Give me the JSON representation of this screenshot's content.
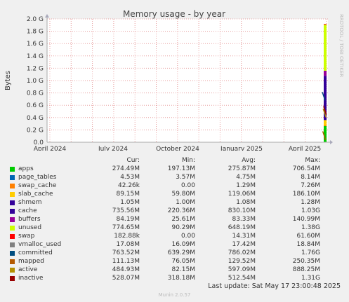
{
  "chart_data": {
    "type": "area",
    "title": "Memory usage - by year",
    "ylabel": "Bytes",
    "side_label": "RRDTOOL / TOBI OETIKER",
    "ylim": [
      0,
      2.0
    ],
    "y_ticks": [
      "0.0",
      "0.2 G",
      "0.4 G",
      "0.6 G",
      "0.8 G",
      "1.0 G",
      "1.2 G",
      "1.4 G",
      "1.6 G",
      "1.8 G",
      "2.0 G"
    ],
    "x_ticks": [
      "April 2024",
      "July 2024",
      "October 2024",
      "January 2025",
      "April 2025"
    ],
    "grid": true,
    "columns": [
      "Cur:",
      "Min:",
      "Avg:",
      "Max:"
    ],
    "series": [
      {
        "name": "apps",
        "color": "#00cc00",
        "cur": "274.49M",
        "min": "197.13M",
        "avg": "275.87M",
        "max": "706.54M"
      },
      {
        "name": "page_tables",
        "color": "#0066b3",
        "cur": "4.53M",
        "min": "3.57M",
        "avg": "4.75M",
        "max": "8.14M"
      },
      {
        "name": "swap_cache",
        "color": "#ff8000",
        "cur": "42.26k",
        "min": "0.00",
        "avg": "1.29M",
        "max": "7.26M"
      },
      {
        "name": "slab_cache",
        "color": "#ffcc00",
        "cur": "89.15M",
        "min": "59.80M",
        "avg": "119.06M",
        "max": "186.10M"
      },
      {
        "name": "shmem",
        "color": "#330099",
        "cur": "1.05M",
        "min": "1.00M",
        "avg": "1.08M",
        "max": "1.28M"
      },
      {
        "name": "cache",
        "color": "#330099",
        "cur": "735.56M",
        "min": "220.36M",
        "avg": "830.10M",
        "max": "1.03G"
      },
      {
        "name": "buffers",
        "color": "#990099",
        "cur": "84.19M",
        "min": "25.61M",
        "avg": "83.33M",
        "max": "140.99M"
      },
      {
        "name": "unused",
        "color": "#ccff00",
        "cur": "774.65M",
        "min": "90.29M",
        "avg": "648.19M",
        "max": "1.38G"
      },
      {
        "name": "swap",
        "color": "#ff0000",
        "cur": "182.88k",
        "min": "0.00",
        "avg": "14.31M",
        "max": "61.60M"
      },
      {
        "name": "vmalloc_used",
        "color": "#808080",
        "cur": "17.08M",
        "min": "16.09M",
        "avg": "17.42M",
        "max": "18.84M"
      },
      {
        "name": "committed",
        "color": "#004d80",
        "cur": "763.52M",
        "min": "639.29M",
        "avg": "786.02M",
        "max": "1.76G"
      },
      {
        "name": "mapped",
        "color": "#b35900",
        "cur": "111.13M",
        "min": "76.05M",
        "avg": "129.52M",
        "max": "250.35M"
      },
      {
        "name": "active",
        "color": "#b38f00",
        "cur": "484.93M",
        "min": "82.15M",
        "avg": "597.09M",
        "max": "888.25M"
      },
      {
        "name": "inactive",
        "color": "#990000",
        "cur": "528.07M",
        "min": "318.18M",
        "avg": "512.54M",
        "max": "1.31G"
      }
    ],
    "last_update": "Last update: Sat May 17 23:00:48 2025",
    "footer": "Munin 2.0.57"
  }
}
